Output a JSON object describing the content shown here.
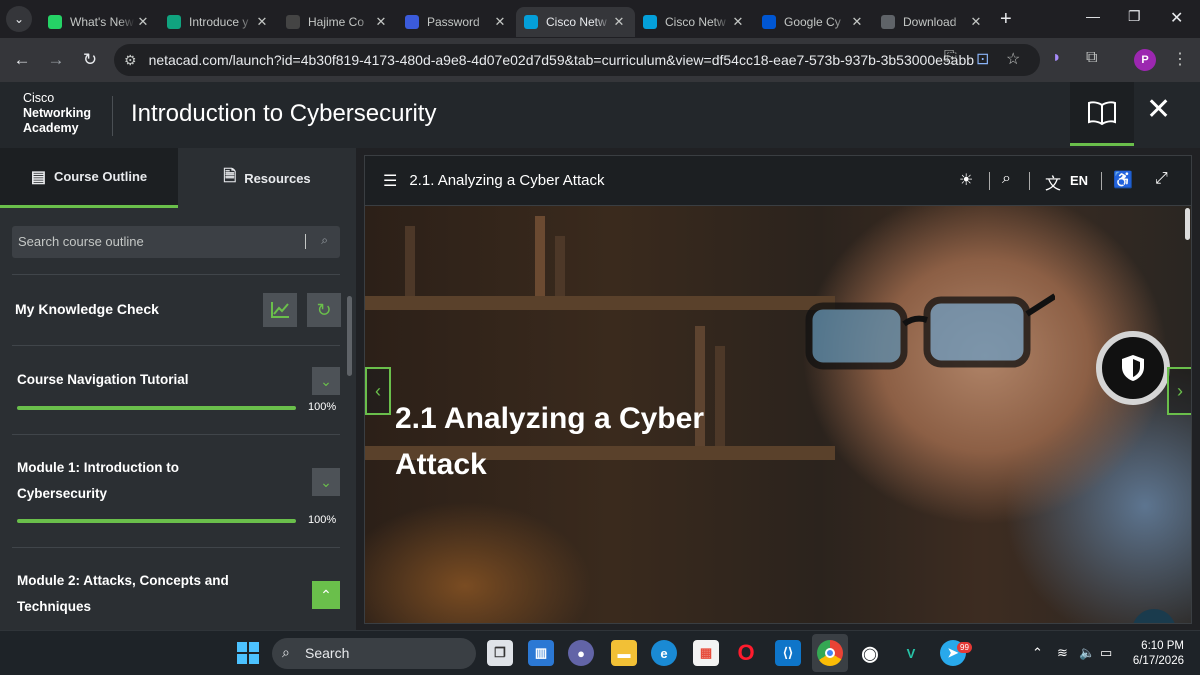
{
  "browser": {
    "tabs": [
      {
        "title": "What's New",
        "favicon": "whatsapp-icon",
        "active": false
      },
      {
        "title": "Introduce y",
        "favicon": "chatgpt-icon",
        "active": false
      },
      {
        "title": "Hajime Co",
        "favicon": "github-icon",
        "active": false
      },
      {
        "title": "Password",
        "favicon": "app-icon",
        "active": false
      },
      {
        "title": "Cisco Netw",
        "favicon": "cisco-icon",
        "active": true
      },
      {
        "title": "Cisco Netw",
        "favicon": "cisco-icon",
        "active": false
      },
      {
        "title": "Google Cy",
        "favicon": "coursera-icon",
        "active": false
      },
      {
        "title": "Download",
        "favicon": "download-icon",
        "active": false
      }
    ],
    "url": "netacad.com/launch?id=4b30f819-4173-480d-a9e8-4d07e02d7d59&tab=curriculum&view=df54cc18-eae7-573b-937b-3b53000e5abb",
    "profile_initial": "P"
  },
  "app": {
    "logo_line1": "Cisco",
    "logo_line2": "Networking",
    "logo_line3": "Academy",
    "course_title": "Introduction to Cybersecurity"
  },
  "sidebar": {
    "tab_outline": "Course Outline",
    "tab_resources": "Resources",
    "search_placeholder": "Search course outline",
    "knowledge_check": "My Knowledge Check",
    "modules": [
      {
        "title_line1": "Course Navigation Tutorial",
        "title_line2": "",
        "progress": "100%",
        "progress_value": 1.0,
        "expanded": false
      },
      {
        "title_line1": "Module 1: Introduction to",
        "title_line2": "Cybersecurity",
        "progress": "100%",
        "progress_value": 1.0,
        "expanded": false
      },
      {
        "title_line1": "Module 2: Attacks, Concepts and",
        "title_line2": "Techniques",
        "progress": "",
        "expanded": true
      }
    ]
  },
  "content": {
    "section_title": "2.1. Analyzing a Cyber Attack",
    "language": "EN",
    "hero_title_line1": "2.1 Analyzing a Cyber",
    "hero_title_line2": "Attack"
  },
  "taskbar": {
    "search_label": "Search",
    "time": "6:10 PM",
    "date": "6/17/2026",
    "telegram_badge": "99"
  },
  "colors": {
    "accent": "#6abf4b",
    "header_bg": "#23272b",
    "sidebar_bg": "#2b2f33"
  }
}
